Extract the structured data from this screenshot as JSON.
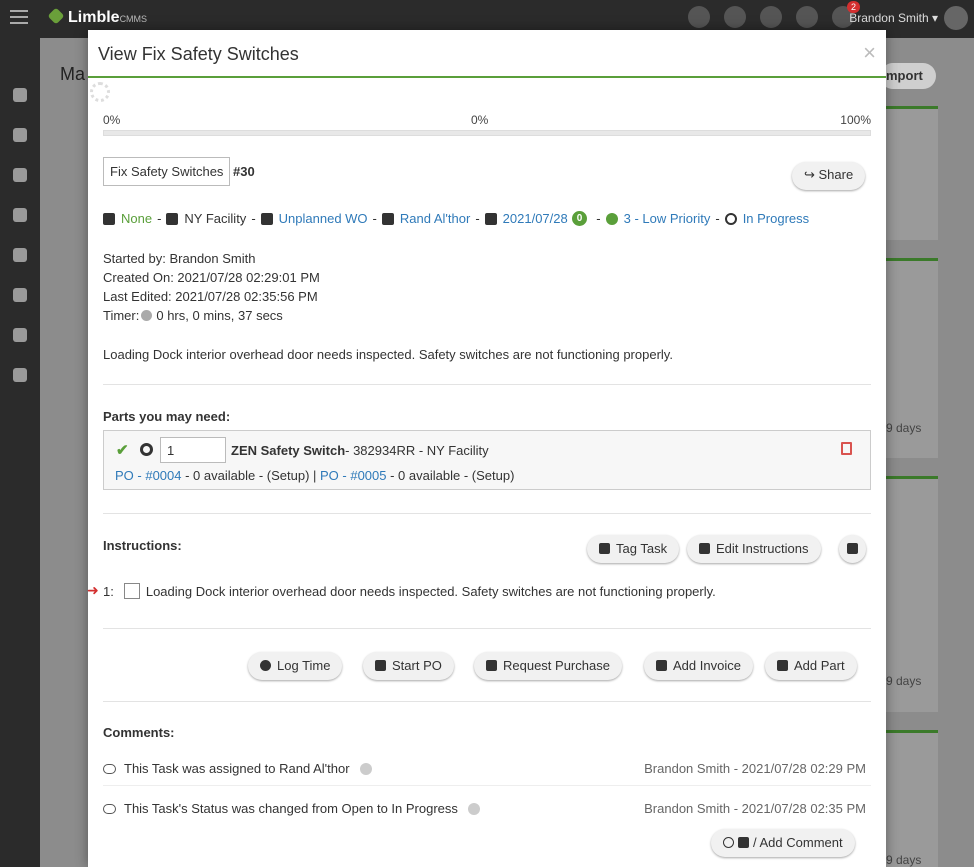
{
  "topbar": {
    "app_name": "Limble",
    "app_suffix": "CMMS",
    "notification_count": "2",
    "user_name": "Brandon Smith"
  },
  "background": {
    "page_title": "Ma",
    "import_label": "mport",
    "days_labels": [
      "9 days",
      "9 days",
      "9 days"
    ]
  },
  "modal": {
    "title": "View Fix Safety Switches",
    "close_icon": "×",
    "progress": {
      "left": "0%",
      "mid": "0%",
      "right": "100%",
      "value": 0
    },
    "task_name": "Fix Safety Switches",
    "task_number": "#30",
    "share_label": "Share",
    "meta": {
      "asset": "None",
      "location": "NY Facility",
      "type": "Unplanned WO",
      "assignee": "Rand Al'thor",
      "due_date": "2021/07/28",
      "due_badge": "0",
      "priority": "3 - Low Priority",
      "status": "In Progress"
    },
    "info": {
      "started_by": "Started by: Brandon Smith",
      "created_on": "Created On: 2021/07/28 02:29:01 PM",
      "last_edited": "Last Edited: 2021/07/28 02:35:56 PM",
      "timer_label": "Timer:",
      "timer_value": "0 hrs, 0 mins, 37 secs"
    },
    "description": "Loading Dock interior overhead door needs inspected. Safety switches are not functioning properly.",
    "parts": {
      "label": "Parts you may need:",
      "qty": "1",
      "part_name": "ZEN Safety Switch",
      "part_detail": "- 382934RR - NY Facility",
      "po1_link": "PO - #0004",
      "po1_text": " - 0 available - (Setup) | ",
      "po2_link": "PO - #0005",
      "po2_text": " - 0 available - (Setup)"
    },
    "instructions": {
      "label": "Instructions:",
      "tag_task": "Tag Task",
      "edit_instructions": "Edit Instructions",
      "item_number": "1:",
      "item_text": "Loading Dock interior overhead door needs inspected. Safety switches are not functioning properly."
    },
    "actions": {
      "log_time": "Log Time",
      "start_po": "Start PO",
      "request_purchase": "Request Purchase",
      "add_invoice": "Add Invoice",
      "add_part": "Add Part"
    },
    "comments": {
      "label": "Comments:",
      "items": [
        {
          "text": "This Task was assigned to Rand Al'thor",
          "meta": "Brandon Smith - 2021/07/28 02:29 PM"
        },
        {
          "text": "This Task's Status was changed from Open to In Progress",
          "meta": "Brandon Smith - 2021/07/28 02:35 PM"
        }
      ],
      "add_comment": "/ Add Comment"
    }
  },
  "colors": {
    "accent_green": "#5a9f3a",
    "link_blue": "#2f7ab9",
    "danger_red": "#d32f2f"
  }
}
